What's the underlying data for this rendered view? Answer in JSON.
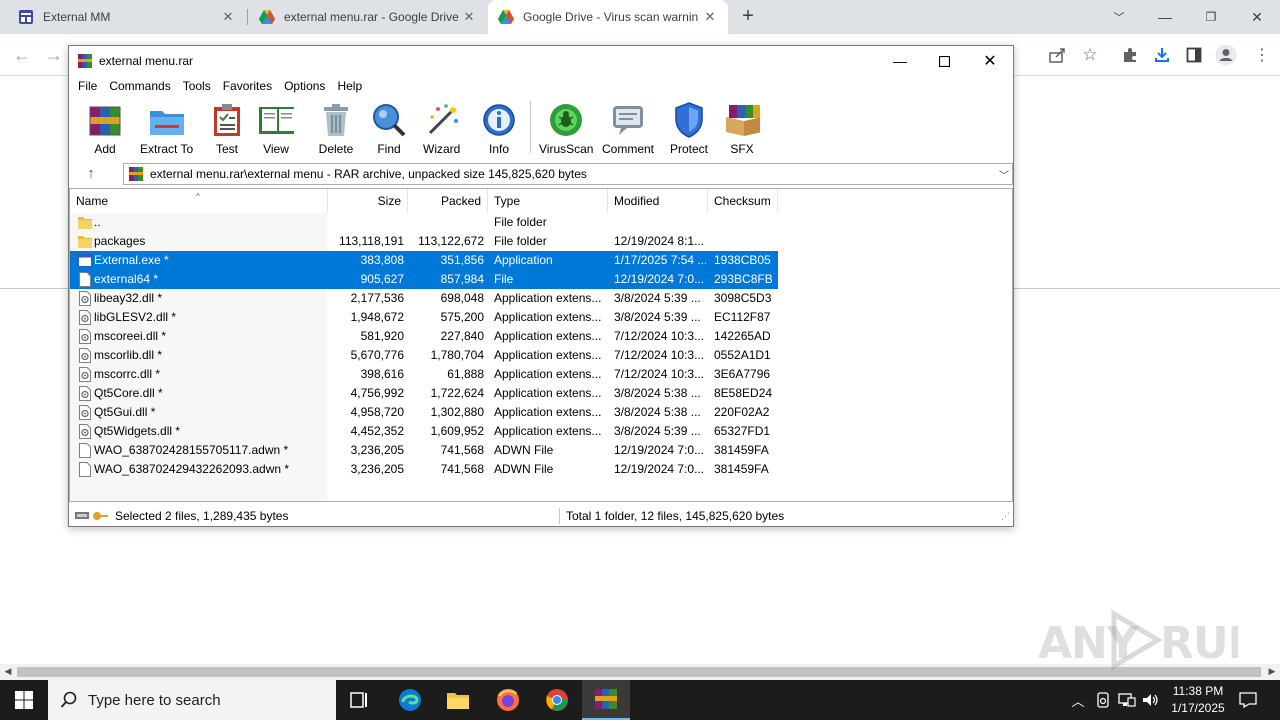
{
  "browser": {
    "tabs": [
      {
        "title": "External MM",
        "active": false
      },
      {
        "title": "external menu.rar - Google Drive",
        "active": false
      },
      {
        "title": "Google Drive - Virus scan warnin",
        "active": true
      }
    ]
  },
  "winrar": {
    "title": "external menu.rar",
    "menu": [
      "File",
      "Commands",
      "Tools",
      "Favorites",
      "Options",
      "Help"
    ],
    "toolbar": [
      "Add",
      "Extract To",
      "Test",
      "View",
      "Delete",
      "Find",
      "Wizard",
      "Info",
      "VirusScan",
      "Comment",
      "Protect",
      "SFX"
    ],
    "address": "external menu.rar\\external menu - RAR archive, unpacked size 145,825,620 bytes",
    "columns": [
      "Name",
      "Size",
      "Packed",
      "Type",
      "Modified",
      "Checksum"
    ],
    "rows": [
      {
        "name": "..",
        "size": "",
        "packed": "",
        "type": "File folder",
        "modified": "",
        "checksum": "",
        "icon": "folder",
        "selected": false
      },
      {
        "name": "packages",
        "size": "113,118,191",
        "packed": "113,122,672",
        "type": "File folder",
        "modified": "12/19/2024 8:1...",
        "checksum": "",
        "icon": "folder",
        "selected": false
      },
      {
        "name": "External.exe *",
        "size": "383,808",
        "packed": "351,856",
        "type": "Application",
        "modified": "1/17/2025 7:54 ...",
        "checksum": "1938CB05",
        "icon": "exe",
        "selected": true
      },
      {
        "name": "external64 *",
        "size": "905,627",
        "packed": "857,984",
        "type": "File",
        "modified": "12/19/2024 7:0...",
        "checksum": "293BC8FB",
        "icon": "file",
        "selected": true
      },
      {
        "name": "libeay32.dll *",
        "size": "2,177,536",
        "packed": "698,048",
        "type": "Application extens...",
        "modified": "3/8/2024 5:39 ...",
        "checksum": "3098C5D3",
        "icon": "dll",
        "selected": false
      },
      {
        "name": "libGLESV2.dll *",
        "size": "1,948,672",
        "packed": "575,200",
        "type": "Application extens...",
        "modified": "3/8/2024 5:39 ...",
        "checksum": "EC112F87",
        "icon": "dll",
        "selected": false
      },
      {
        "name": "mscoreei.dll *",
        "size": "581,920",
        "packed": "227,840",
        "type": "Application extens...",
        "modified": "7/12/2024 10:3...",
        "checksum": "142265AD",
        "icon": "dll",
        "selected": false
      },
      {
        "name": "mscorlib.dll *",
        "size": "5,670,776",
        "packed": "1,780,704",
        "type": "Application extens...",
        "modified": "7/12/2024 10:3...",
        "checksum": "0552A1D1",
        "icon": "dll",
        "selected": false
      },
      {
        "name": "mscorrc.dll *",
        "size": "398,616",
        "packed": "61,888",
        "type": "Application extens...",
        "modified": "7/12/2024 10:3...",
        "checksum": "3E6A7796",
        "icon": "dll",
        "selected": false
      },
      {
        "name": "Qt5Core.dll *",
        "size": "4,756,992",
        "packed": "1,722,624",
        "type": "Application extens...",
        "modified": "3/8/2024 5:38 ...",
        "checksum": "8E58ED24",
        "icon": "dll",
        "selected": false
      },
      {
        "name": "Qt5Gui.dll *",
        "size": "4,958,720",
        "packed": "1,302,880",
        "type": "Application extens...",
        "modified": "3/8/2024 5:38 ...",
        "checksum": "220F02A2",
        "icon": "dll",
        "selected": false
      },
      {
        "name": "Qt5Widgets.dll *",
        "size": "4,452,352",
        "packed": "1,609,952",
        "type": "Application extens...",
        "modified": "3/8/2024 5:39 ...",
        "checksum": "65327FD1",
        "icon": "dll",
        "selected": false
      },
      {
        "name": "WAO_638702428155705117.adwn *",
        "size": "3,236,205",
        "packed": "741,568",
        "type": "ADWN File",
        "modified": "12/19/2024 7:0...",
        "checksum": "381459FA",
        "icon": "file",
        "selected": false
      },
      {
        "name": "WAO_638702429432262093.adwn *",
        "size": "3,236,205",
        "packed": "741,568",
        "type": "ADWN File",
        "modified": "12/19/2024 7:0...",
        "checksum": "381459FA",
        "icon": "file",
        "selected": false
      }
    ],
    "status_left": "Selected 2 files, 1,289,435 bytes",
    "status_right": "Total 1 folder, 12 files, 145,825,620 bytes"
  },
  "watermark": "ANY RUN",
  "taskbar": {
    "search_placeholder": "Type here to search",
    "time": "11:38 PM",
    "date": "1/17/2025"
  },
  "colors": {
    "selection": "#0078d7",
    "taskbar": "#1c1c1c",
    "tabstrip": "#dee1e6"
  }
}
